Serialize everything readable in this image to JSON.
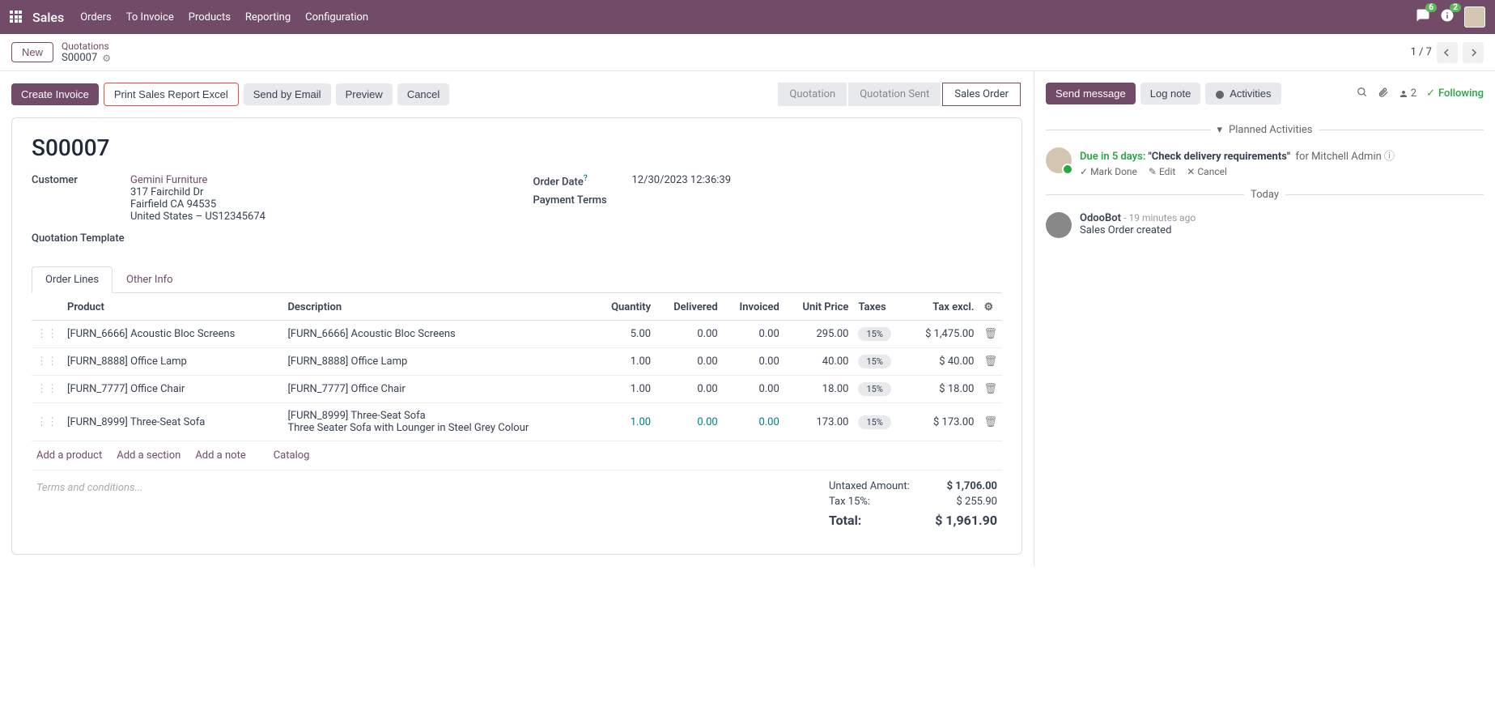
{
  "navbar": {
    "brand": "Sales",
    "menu": [
      "Orders",
      "To Invoice",
      "Products",
      "Reporting",
      "Configuration"
    ],
    "msg_count": "6",
    "activity_count": "2"
  },
  "breadcrumb": {
    "new_btn": "New",
    "parent": "Quotations",
    "current": "S00007",
    "pager": "1 / 7"
  },
  "actions": {
    "create_invoice": "Create Invoice",
    "print_excel": "Print Sales Report Excel",
    "send_email": "Send by Email",
    "preview": "Preview",
    "cancel": "Cancel"
  },
  "status": {
    "quotation": "Quotation",
    "quotation_sent": "Quotation Sent",
    "sales_order": "Sales Order"
  },
  "form": {
    "title": "S00007",
    "customer_label": "Customer",
    "customer_name": "Gemini Furniture",
    "customer_addr1": "317 Fairchild Dr",
    "customer_addr2": "Fairfield CA 94535",
    "customer_addr3": "United States – US12345674",
    "template_label": "Quotation Template",
    "order_date_label": "Order Date",
    "order_date_value": "12/30/2023 12:36:39",
    "payment_terms_label": "Payment Terms"
  },
  "tabs": {
    "order_lines": "Order Lines",
    "other_info": "Other Info"
  },
  "table": {
    "headers": {
      "product": "Product",
      "description": "Description",
      "quantity": "Quantity",
      "delivered": "Delivered",
      "invoiced": "Invoiced",
      "unit_price": "Unit Price",
      "taxes": "Taxes",
      "tax_excl": "Tax excl."
    },
    "rows": [
      {
        "product": "[FURN_6666] Acoustic Bloc Screens",
        "description": "[FURN_6666] Acoustic Bloc Screens",
        "qty": "5.00",
        "delivered": "0.00",
        "invoiced": "0.00",
        "price": "295.00",
        "tax": "15%",
        "subtotal": "$ 1,475.00"
      },
      {
        "product": "[FURN_8888] Office Lamp",
        "description": "[FURN_8888] Office Lamp",
        "qty": "1.00",
        "delivered": "0.00",
        "invoiced": "0.00",
        "price": "40.00",
        "tax": "15%",
        "subtotal": "$ 40.00"
      },
      {
        "product": "[FURN_7777] Office Chair",
        "description": "[FURN_7777] Office Chair",
        "qty": "1.00",
        "delivered": "0.00",
        "invoiced": "0.00",
        "price": "18.00",
        "tax": "15%",
        "subtotal": "$ 18.00"
      },
      {
        "product": "[FURN_8999] Three-Seat Sofa",
        "description": "[FURN_8999] Three-Seat Sofa\nThree Seater Sofa with Lounger in Steel Grey Colour",
        "qty": "1.00",
        "delivered": "0.00",
        "invoiced": "0.00",
        "price": "173.00",
        "tax": "15%",
        "subtotal": "$ 173.00",
        "editable": true
      }
    ],
    "links": {
      "add_product": "Add a product",
      "add_section": "Add a section",
      "add_note": "Add a note",
      "catalog": "Catalog"
    }
  },
  "terms_placeholder": "Terms and conditions...",
  "totals": {
    "untaxed_label": "Untaxed Amount:",
    "untaxed_value": "$ 1,706.00",
    "tax_label": "Tax 15%:",
    "tax_value": "$ 255.90",
    "total_label": "Total:",
    "total_value": "$ 1,961.90"
  },
  "chatter": {
    "send_message": "Send message",
    "log_note": "Log note",
    "activities": "Activities",
    "followers_count": "2",
    "following": "Following",
    "planned_header": "Planned Activities",
    "activity": {
      "due": "Due in 5 days:",
      "title": "\"Check delivery requirements\"",
      "for": "for Mitchell Admin",
      "mark_done": "Mark Done",
      "edit": "Edit",
      "cancel": "Cancel"
    },
    "today_header": "Today",
    "log": {
      "author": "OdooBot",
      "time": "- 19 minutes ago",
      "body": "Sales Order created"
    }
  }
}
